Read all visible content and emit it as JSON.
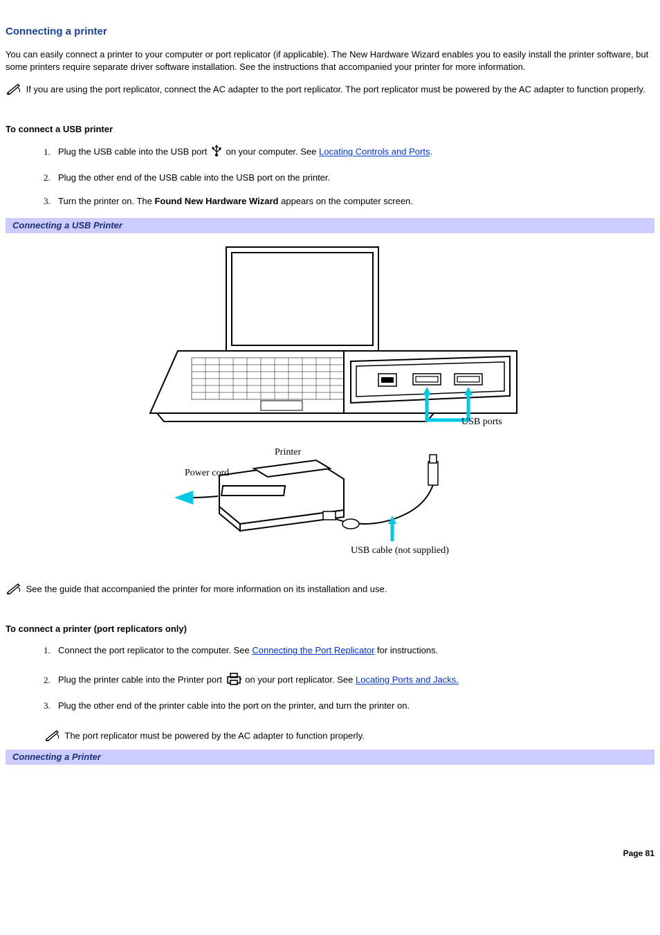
{
  "title": "Connecting a printer",
  "intro": "You can easily connect a printer to your computer or port replicator (if applicable). The New Hardware Wizard enables you to easily install the printer software, but some printers require separate driver software installation. See the instructions that accompanied your printer for more information.",
  "note1": "If you are using the port replicator, connect the AC adapter to the port replicator. The port replicator must be powered by the AC adapter to function properly.",
  "usb": {
    "heading": "To connect a USB printer",
    "step1a": "Plug the USB cable into the USB port ",
    "step1b": " on your computer. See ",
    "step1_link": "Locating Controls and Ports",
    "step1c": ".",
    "step2": "Plug the other end of the USB cable into the USB port on the printer.",
    "step3a": "Turn the printer on. The ",
    "step3_bold": "Found New Hardware Wizard",
    "step3b": " appears on the computer screen."
  },
  "caption1": "Connecting a USB Printer",
  "figure_labels": {
    "usb_ports": "USB ports",
    "printer": "Printer",
    "power_cord": "Power cord",
    "usb_cable": "USB cable (not supplied)"
  },
  "note2": "See the guide that accompanied the printer for more information on its installation and use.",
  "port": {
    "heading": "To connect a printer (port replicators only)",
    "step1a": "Connect the port replicator to the computer. See ",
    "step1_link": "Connecting the Port Replicator",
    "step1b": " for instructions.",
    "step2a": "Plug the printer cable into the Printer port ",
    "step2b": " on your port replicator. See ",
    "step2_link": "Locating Ports and Jacks.",
    "step3": "Plug the other end of the printer cable into the port on the printer, and turn the printer on.",
    "inner_note": "The port replicator must be powered by the AC adapter to function properly."
  },
  "caption2": "Connecting a Printer",
  "page_label": "Page 81"
}
